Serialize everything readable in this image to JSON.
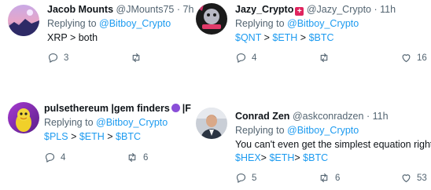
{
  "tweets": [
    {
      "name": "Jacob Mounts",
      "handle": "@JMounts75",
      "sep": "·",
      "time": "7h",
      "replying": "Replying to",
      "replying_to": "@Bitboy_Crypto",
      "text": "XRP > both",
      "reply_count": "3",
      "retweet_count": "",
      "like_count": ""
    },
    {
      "name": "Jazy_Crypto",
      "handle": "@Jazy_Crypto",
      "sep": "·",
      "time": "11h",
      "replying": "Replying to",
      "replying_to": "@Bitboy_Crypto",
      "text_parts": [
        "$QNT",
        " > ",
        "$ETH",
        " > ",
        "$BTC"
      ],
      "reply_count": "4",
      "retweet_count": "",
      "like_count": "16"
    },
    {
      "name": "pulsethereum |gem finders",
      "name_suffix": "|F",
      "replying": "Replying to",
      "replying_to": "@Bitboy_Crypto",
      "text_parts": [
        "$PLS",
        " > ",
        "$ETH",
        " > ",
        "$BTC"
      ],
      "reply_count": "4",
      "retweet_count": "6",
      "like_count": ""
    },
    {
      "name": "Conrad Zen",
      "handle": "@askconradzen",
      "sep": "·",
      "time": "11h",
      "replying": "Replying to",
      "replying_to": "@Bitboy_Crypto",
      "text_line1": "You can't even get the simplest equation right,",
      "text_parts": [
        "$HEX",
        "> ",
        "$ETH",
        "> ",
        "$BTC"
      ],
      "reply_count": "5",
      "retweet_count": "6",
      "like_count": "53"
    }
  ],
  "colors": {
    "link": "#1d9bf0",
    "muted": "#536471",
    "text": "#0f1419",
    "badge": "#e0245e"
  },
  "icons": [
    "reply-icon",
    "retweet-icon",
    "like-icon"
  ]
}
